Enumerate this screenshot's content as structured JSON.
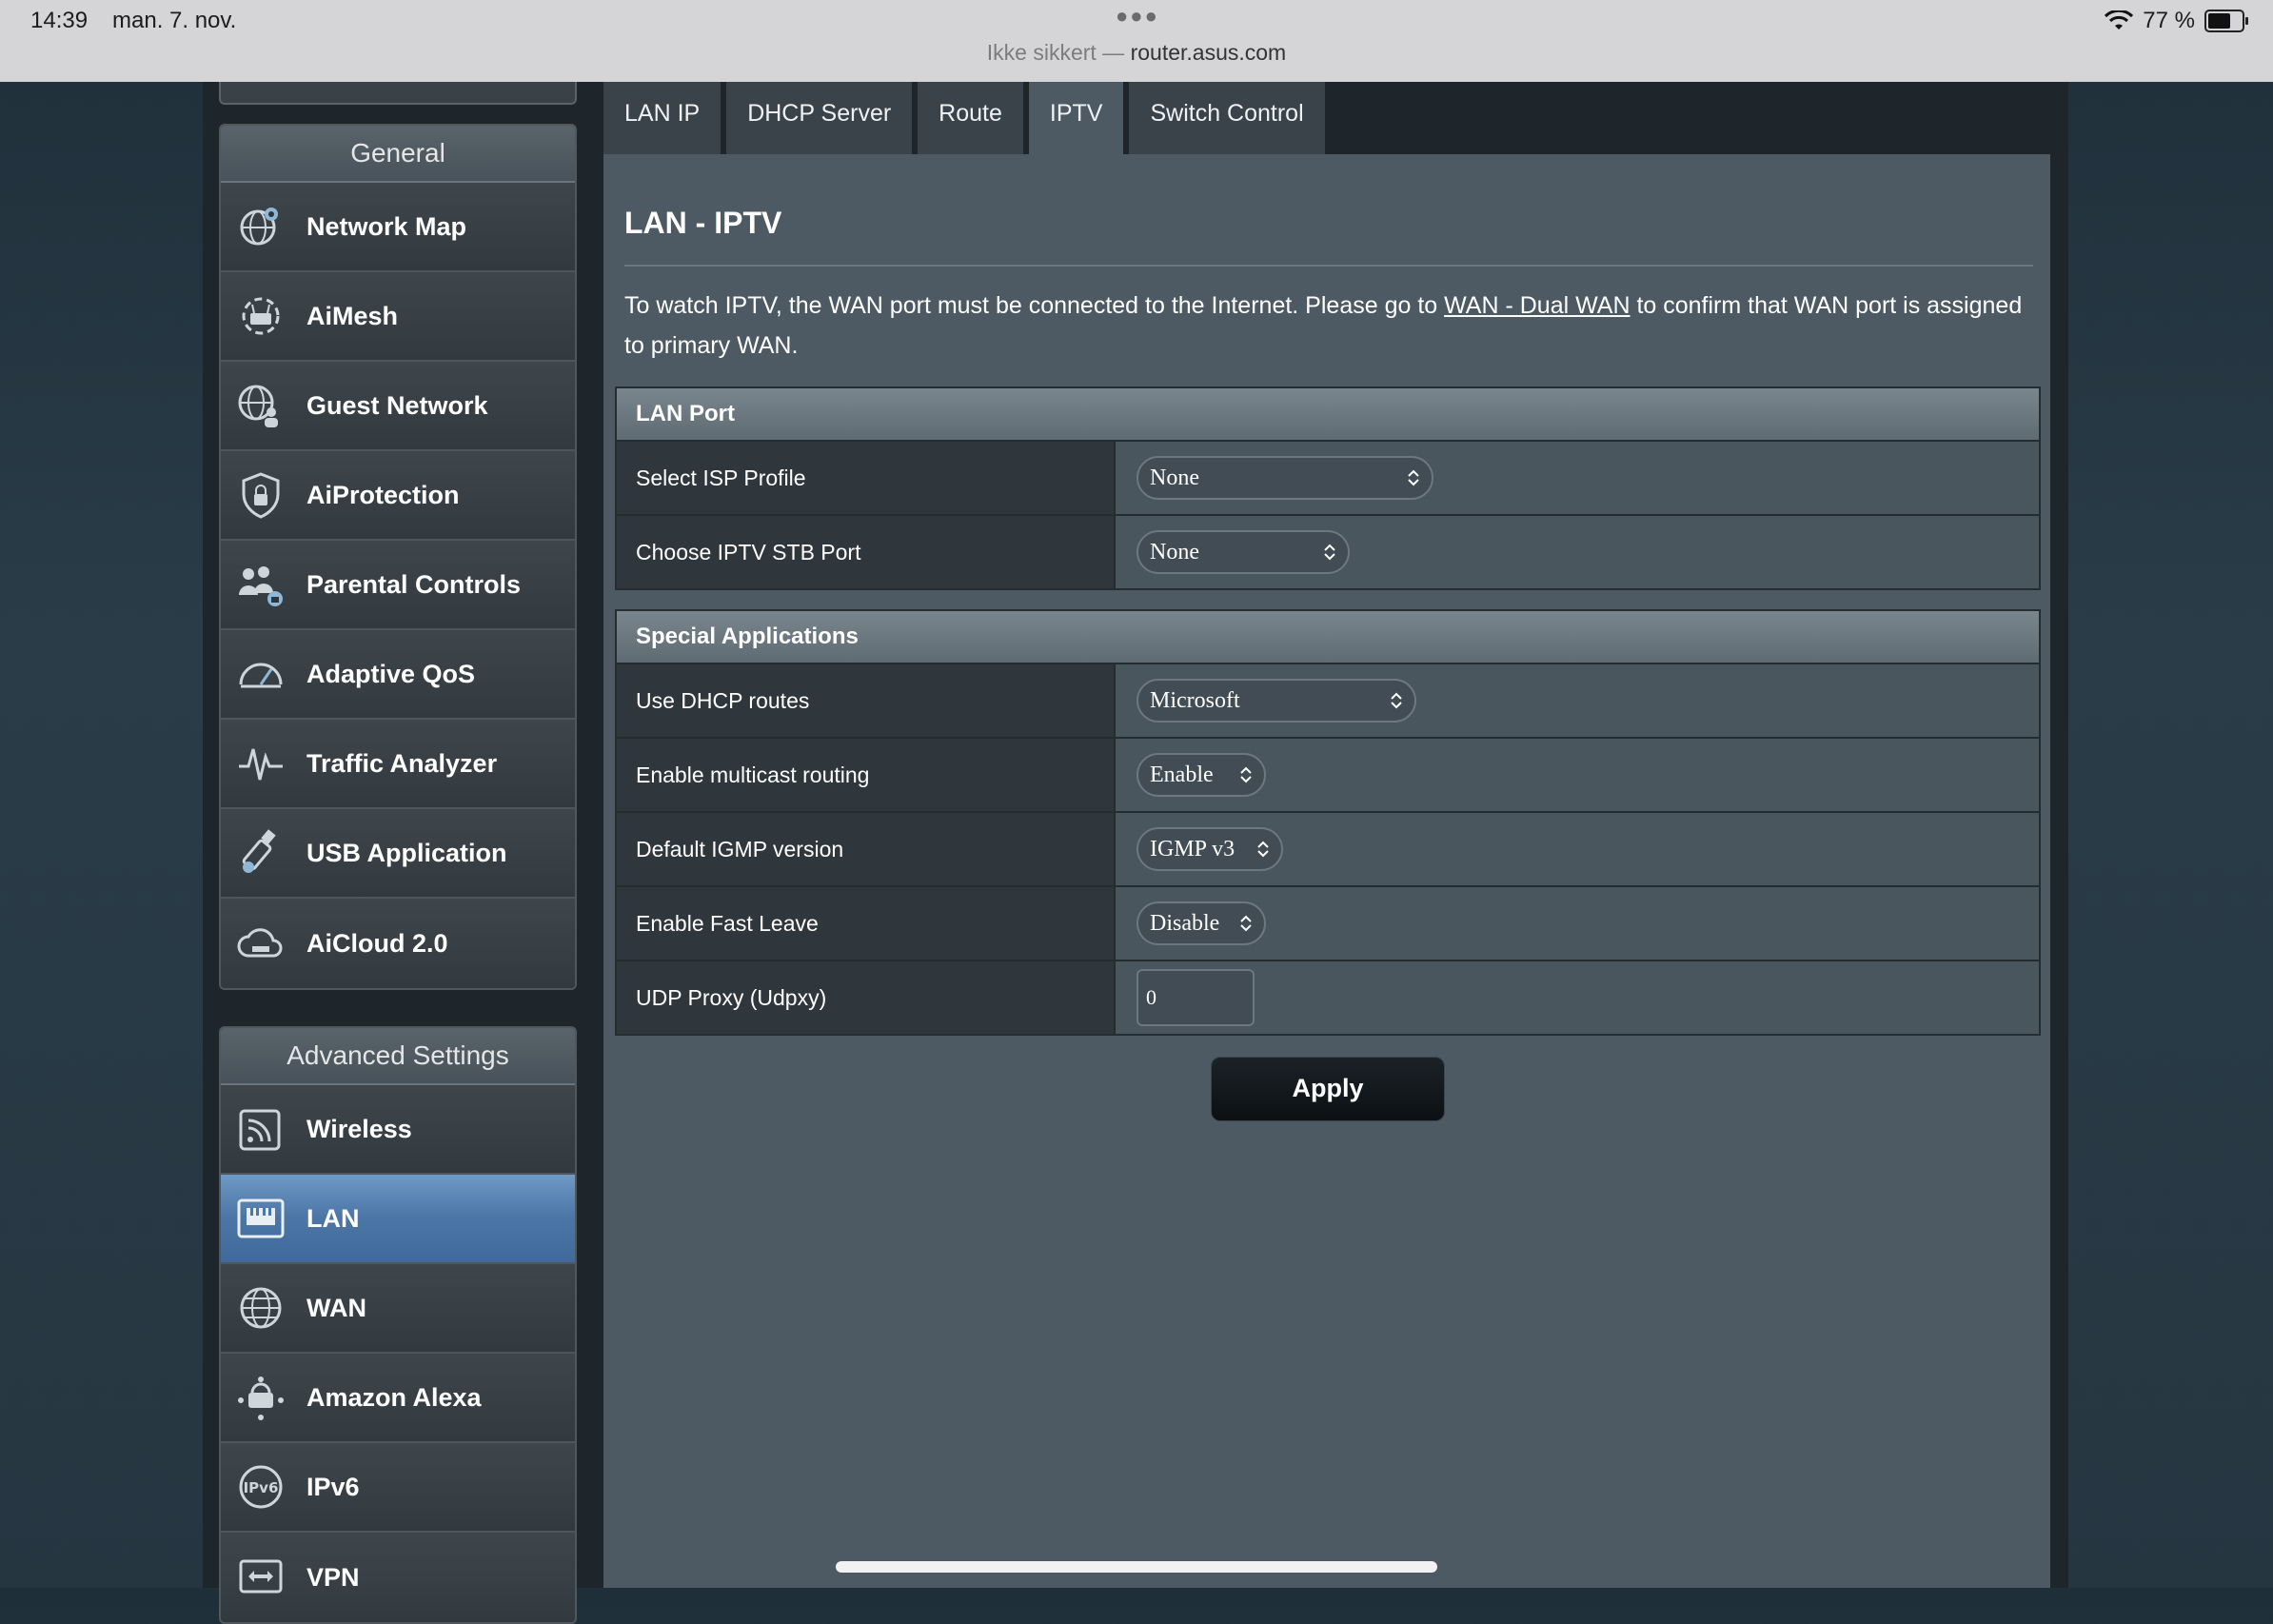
{
  "statusbar": {
    "time": "14:39",
    "date": "man. 7. nov.",
    "url_prefix": "Ikke sikkert —",
    "url": "router.asus.com",
    "battery": "77 %",
    "battery_level": 0.77
  },
  "tabs": [
    {
      "label": "LAN IP"
    },
    {
      "label": "DHCP Server"
    },
    {
      "label": "Route"
    },
    {
      "label": "IPTV"
    },
    {
      "label": "Switch Control"
    }
  ],
  "sidebar": {
    "general_title": "General",
    "general_items": [
      {
        "label": "Network Map",
        "icon": "globe-pin-icon"
      },
      {
        "label": "AiMesh",
        "icon": "mesh-router-icon"
      },
      {
        "label": "Guest Network",
        "icon": "guest-globe-icon"
      },
      {
        "label": "AiProtection",
        "icon": "shield-lock-icon"
      },
      {
        "label": "Parental Controls",
        "icon": "family-lock-icon"
      },
      {
        "label": "Adaptive QoS",
        "icon": "gauge-icon"
      },
      {
        "label": "Traffic Analyzer",
        "icon": "pulse-icon"
      },
      {
        "label": "USB Application",
        "icon": "usb-icon"
      },
      {
        "label": "AiCloud 2.0",
        "icon": "cloud-icon"
      }
    ],
    "advanced_title": "Advanced Settings",
    "advanced_items": [
      {
        "label": "Wireless",
        "icon": "wireless-icon"
      },
      {
        "label": "LAN",
        "icon": "lan-port-icon"
      },
      {
        "label": "WAN",
        "icon": "globe-icon"
      },
      {
        "label": "Amazon Alexa",
        "icon": "alexa-icon"
      },
      {
        "label": "IPv6",
        "icon": "ipv6-icon"
      },
      {
        "label": "VPN",
        "icon": "vpn-icon"
      }
    ]
  },
  "main": {
    "title": "LAN - IPTV",
    "intro_before": "To watch IPTV, the WAN port must be connected to the Internet. Please go to ",
    "intro_link": "WAN - Dual WAN",
    "intro_after": " to confirm that WAN port is assigned to primary WAN.",
    "lan_port": {
      "header": "LAN Port",
      "isp_profile_label": "Select ISP Profile",
      "isp_profile_value": "None",
      "stb_port_label": "Choose IPTV STB Port",
      "stb_port_value": "None"
    },
    "special": {
      "header": "Special Applications",
      "dhcp_routes_label": "Use DHCP routes",
      "dhcp_routes_value": "Microsoft",
      "multicast_label": "Enable multicast routing",
      "multicast_value": "Enable",
      "igmp_label": "Default IGMP version",
      "igmp_value": "IGMP v3",
      "fast_leave_label": "Enable Fast Leave",
      "fast_leave_value": "Disable",
      "udpxy_label": "UDP Proxy (Udpxy)",
      "udpxy_value": "0"
    },
    "apply_label": "Apply"
  }
}
